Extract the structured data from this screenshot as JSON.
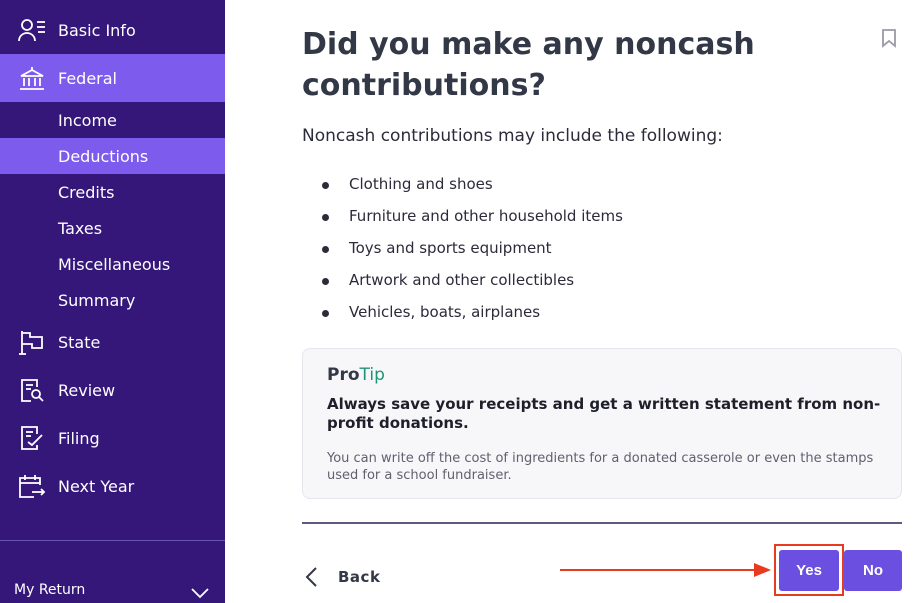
{
  "sidebar": {
    "items": [
      {
        "label": "Basic Info",
        "icon": "user-list-icon"
      },
      {
        "label": "Federal",
        "icon": "bank-building-icon"
      },
      {
        "label": "State",
        "icon": "flag-icon"
      },
      {
        "label": "Review",
        "icon": "document-search-icon"
      },
      {
        "label": "Filing",
        "icon": "document-check-icon"
      },
      {
        "label": "Next Year",
        "icon": "calendar-arrow-icon"
      }
    ],
    "federal_sub": [
      "Income",
      "Deductions",
      "Credits",
      "Taxes",
      "Miscellaneous",
      "Summary"
    ],
    "active_item": "Federal",
    "active_sub": "Deductions",
    "footer_label": "My Return"
  },
  "main": {
    "title": "Did you make any noncash contributions?",
    "intro": "Noncash contributions may include the following:",
    "bullets": [
      "Clothing and shoes",
      "Furniture and other household items",
      "Toys and sports equipment",
      "Artwork and other collectibles",
      "Vehicles, boats, airplanes"
    ],
    "protip": {
      "pro": "Pro",
      "tip": "Tip",
      "title": "Always save your receipts and get a written statement from non-profit donations.",
      "body": "You can write off the cost of ingredients for a donated casserole or even the stamps used for a school fundraiser."
    },
    "back_label": "Back",
    "yes_label": "Yes",
    "no_label": "No"
  },
  "colors": {
    "sidebar_bg": "#35177a",
    "sidebar_active": "#7d5ced",
    "button": "#6a4fe0",
    "tip_green": "#1d9377",
    "annotation_red": "#e83a1f"
  }
}
